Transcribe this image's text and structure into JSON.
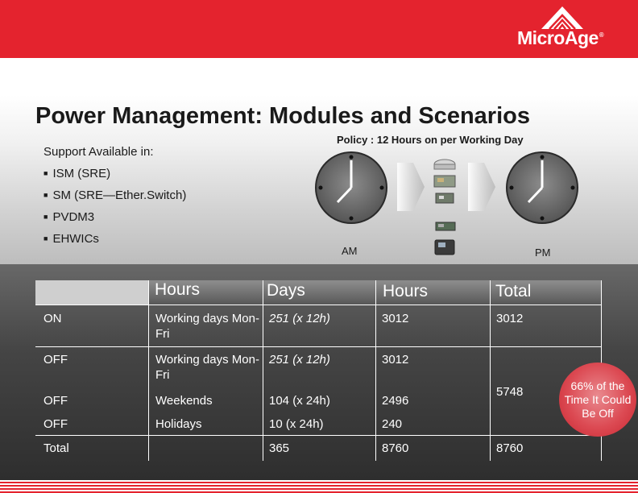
{
  "brand": {
    "logo_text": "MicroAge",
    "trademark": "®",
    "color": "#e4232e"
  },
  "title": "Power Management: Modules and Scenarios",
  "support": {
    "heading": "Support Available in:",
    "items": [
      "ISM (SRE)",
      "SM (SRE—Ether.Switch)",
      "PVDM3",
      "EHWICs"
    ]
  },
  "diagram": {
    "policy": "Policy : 12 Hours on per Working Day",
    "am_label": "AM",
    "pm_label": "PM",
    "icons": [
      "clock-am-icon",
      "arrow-right-icon",
      "router-icon",
      "module-card-icon",
      "dsp-card-icon",
      "wic-card-icon",
      "ip-phone-icon",
      "clock-pm-icon"
    ]
  },
  "table": {
    "headers": [
      "",
      "Hours",
      "Days",
      "Hours",
      "Total"
    ],
    "rows": [
      {
        "state": "ON",
        "period": "Working days Mon-Fri",
        "days": "251 (x 12h)",
        "hours": "3012",
        "total": "3012"
      },
      {
        "state": "OFF",
        "period": "Working days Mon-Fri",
        "days": "251 (x 12h)",
        "hours": "3012",
        "total": ""
      },
      {
        "state": "OFF",
        "period": "Weekends",
        "days": "104 (x 24h)",
        "hours": "2496",
        "total": ""
      },
      {
        "state": "OFF",
        "period": "Holidays",
        "days": "10 (x 24h)",
        "hours": "240",
        "total": ""
      }
    ],
    "off_total": "5748",
    "footer": {
      "label": "Total",
      "days": "365",
      "hours": "8760",
      "total": "8760"
    }
  },
  "callout": "66% of the Time It Could Be Off"
}
